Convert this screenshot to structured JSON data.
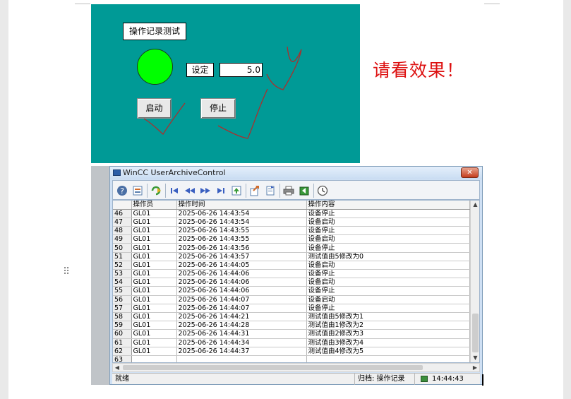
{
  "hmi": {
    "title": "操作记录测试",
    "set_label": "设定",
    "set_value": "5.0",
    "start_label": "启动",
    "stop_label": "停止",
    "lamp_color": "#00ff00",
    "background_color": "#009a96"
  },
  "annotation": {
    "text": "请看效果！",
    "color": "#dd1111"
  },
  "window": {
    "title": "WinCC UserArchiveControl",
    "close_glyph": "✕",
    "toolbar_icons": [
      "help-icon",
      "config-icon",
      "refresh-icon",
      "first-record-icon",
      "previous-record-icon",
      "next-record-icon",
      "last-record-icon",
      "export-icon",
      "import-icon",
      "paste-icon",
      "print-icon",
      "restore-icon",
      "clock-icon"
    ],
    "columns": [
      "",
      "操作员",
      "操作时间",
      "操作内容"
    ],
    "rows": [
      [
        "46",
        "GL01",
        "2025-06-26 14:43:54",
        "设备停止"
      ],
      [
        "47",
        "GL01",
        "2025-06-26 14:43:54",
        "设备启动"
      ],
      [
        "48",
        "GL01",
        "2025-06-26 14:43:55",
        "设备停止"
      ],
      [
        "49",
        "GL01",
        "2025-06-26 14:43:55",
        "设备启动"
      ],
      [
        "50",
        "GL01",
        "2025-06-26 14:43:56",
        "设备停止"
      ],
      [
        "51",
        "GL01",
        "2025-06-26 14:43:57",
        "测试值由5修改为0"
      ],
      [
        "52",
        "GL01",
        "2025-06-26 14:44:05",
        "设备启动"
      ],
      [
        "53",
        "GL01",
        "2025-06-26 14:44:06",
        "设备停止"
      ],
      [
        "54",
        "GL01",
        "2025-06-26 14:44:06",
        "设备启动"
      ],
      [
        "55",
        "GL01",
        "2025-06-26 14:44:06",
        "设备停止"
      ],
      [
        "56",
        "GL01",
        "2025-06-26 14:44:07",
        "设备启动"
      ],
      [
        "57",
        "GL01",
        "2025-06-26 14:44:07",
        "设备停止"
      ],
      [
        "58",
        "GL01",
        "2025-06-26 14:44:21",
        "测试值由5修改为1"
      ],
      [
        "59",
        "GL01",
        "2025-06-26 14:44:28",
        "测试值由1修改为2"
      ],
      [
        "60",
        "GL01",
        "2025-06-26 14:44:31",
        "测试值由2修改为3"
      ],
      [
        "61",
        "GL01",
        "2025-06-26 14:44:34",
        "测试值由3修改为4"
      ],
      [
        "62",
        "GL01",
        "2025-06-26 14:44:37",
        "测试值由4修改为5"
      ],
      [
        "63",
        "",
        "",
        ""
      ]
    ],
    "status": {
      "ready": "就绪",
      "archive": "归档: 操作记录",
      "time": "14:44:43"
    }
  }
}
